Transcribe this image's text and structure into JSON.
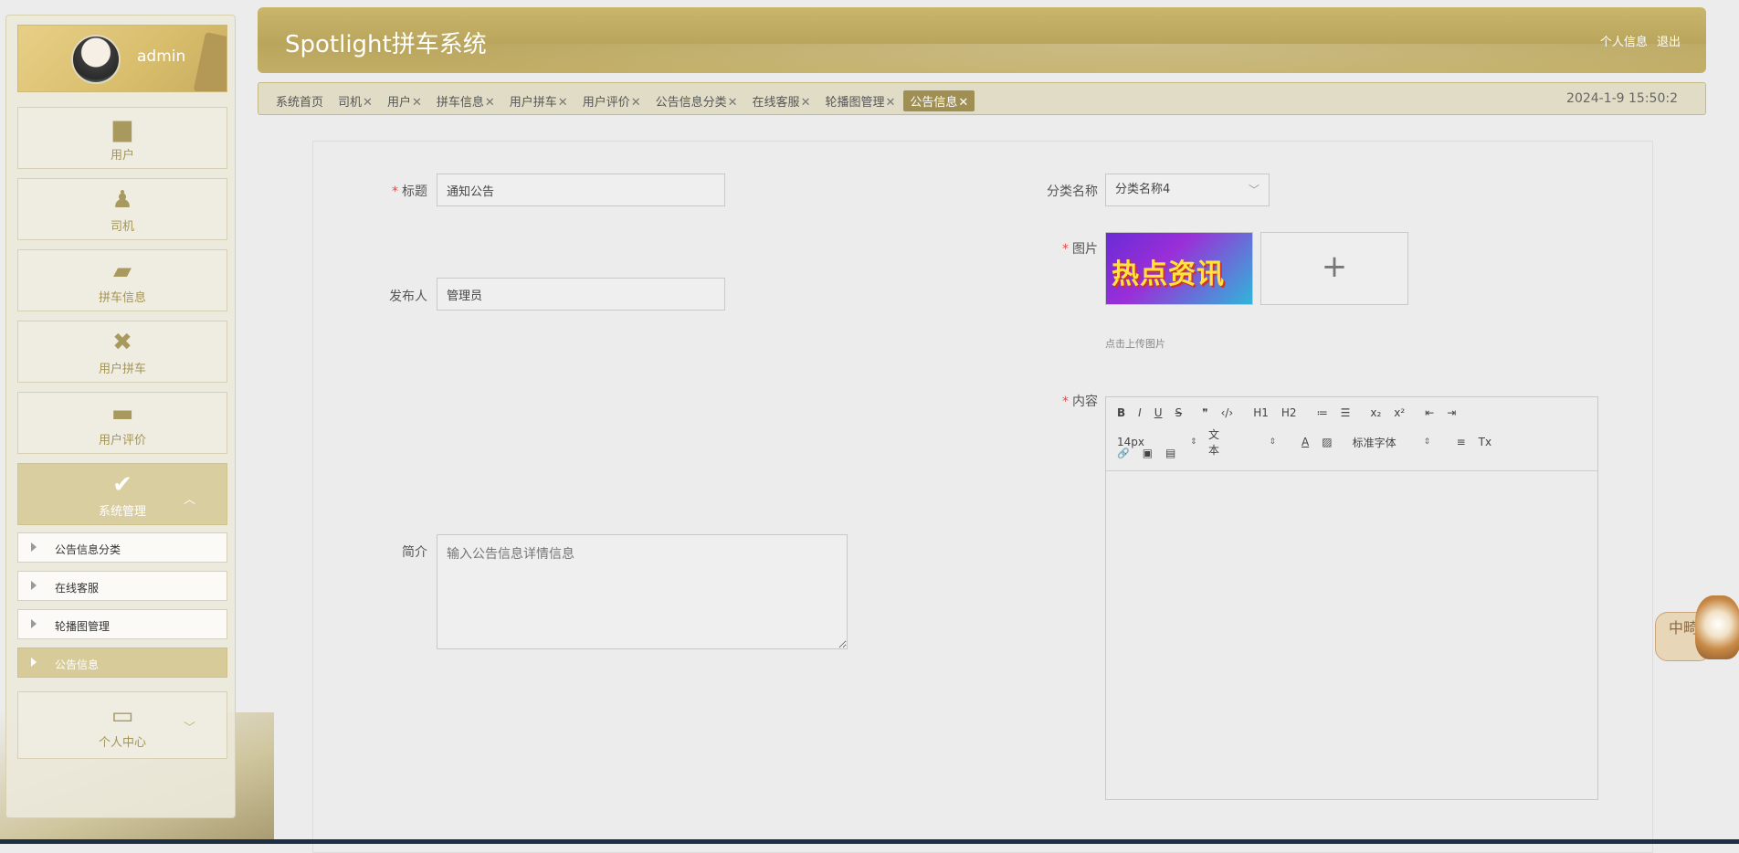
{
  "header": {
    "app_title": "Spotlight拼车系统",
    "links": [
      "个人信息",
      "退出"
    ]
  },
  "user": {
    "name": "admin"
  },
  "sidebar": {
    "menus": [
      {
        "label": "用户",
        "icon": "brush-icon"
      },
      {
        "label": "司机",
        "icon": "person-icon"
      },
      {
        "label": "拼车信息",
        "icon": "wallet-icon"
      },
      {
        "label": "用户拼车",
        "icon": "clipboard-x-icon"
      },
      {
        "label": "用户评价",
        "icon": "briefcase-icon"
      },
      {
        "label": "系统管理",
        "icon": "clipboard-check-icon"
      }
    ],
    "submenus": [
      "公告信息分类",
      "在线客服",
      "轮播图管理",
      "公告信息"
    ],
    "personal": {
      "label": "个人中心",
      "icon": "card-icon"
    }
  },
  "tabs": [
    {
      "label": "系统首页"
    },
    {
      "label": "司机"
    },
    {
      "label": "用户"
    },
    {
      "label": "拼车信息"
    },
    {
      "label": "用户拼车"
    },
    {
      "label": "用户评价"
    },
    {
      "label": "公告信息分类"
    },
    {
      "label": "在线客服"
    },
    {
      "label": "轮播图管理"
    },
    {
      "label": "公告信息"
    }
  ],
  "datetime": "2024-1-9 15:50:2",
  "form": {
    "title_label": "标题",
    "title_value": "通知公告",
    "publisher_label": "发布人",
    "publisher_value": "管理员",
    "summary_label": "简介",
    "summary_placeholder": "输入公告信息详情信息",
    "category_label": "分类名称",
    "category_value": "分类名称4",
    "image_label": "图片",
    "image_text": "热点资讯",
    "upload_plus": "+",
    "upload_hint": "点击上传图片",
    "content_label": "内容"
  },
  "editor": {
    "row1": [
      "B",
      "I",
      "U",
      "S",
      "❞",
      "‹/›",
      "H1",
      "H2",
      "≔",
      "☰",
      "x₂",
      "x²",
      "⇤",
      "⇥"
    ],
    "font_size": "14px",
    "text_style": "文本",
    "font_family": "标准字体",
    "row2_icons": [
      "A",
      "▨",
      "≡",
      "Tx"
    ],
    "row3": [
      "🔗",
      "▣",
      "▤"
    ]
  },
  "widget": {
    "dog_text": "中畸"
  },
  "colors": {
    "accent": "#b9a55c",
    "active_tab": "#9f8f53",
    "required": "#e04b4b"
  }
}
